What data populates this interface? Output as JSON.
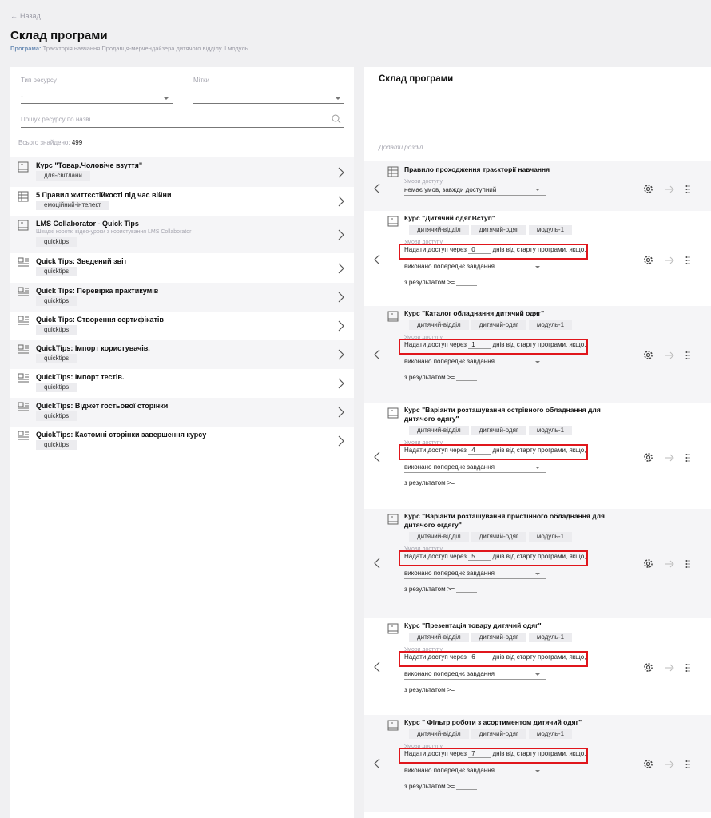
{
  "back_label": "Назад",
  "page_title": "Склад програми",
  "program": {
    "label": "Програма:",
    "value": "Траєкторія навчання Продавця-мерчендайзера дитячого відділу. I модуль"
  },
  "left_panel": {
    "resource_type_label": "Тип ресурсу",
    "resource_type_value": "-",
    "tags_label": "Мітки",
    "tags_value": "",
    "search_placeholder": "Пошук ресурсу по назві",
    "found_label": "Всього знайдено:",
    "found_count": "499",
    "resources": [
      {
        "icon": "course-icon",
        "title": "Курс \"Товар.Чоловіче взуття\"",
        "subtitle": "",
        "tag": "для-світлани"
      },
      {
        "icon": "trajectory-icon",
        "title": "5 Правил життєстійкості під час війни",
        "subtitle": "",
        "tag": "емоційний-інтелект"
      },
      {
        "icon": "course-icon",
        "title": "LMS Collaborator - Quick Tips",
        "subtitle": "Швидкі короткі відео-уроки з користування LMS Collaborator",
        "tag": "quicktips"
      },
      {
        "icon": "material-icon",
        "title": "Quick Tips: Зведений звіт",
        "subtitle": "",
        "tag": "quicktips"
      },
      {
        "icon": "material-icon",
        "title": "Quick Tips: Перевірка практикумів",
        "subtitle": "",
        "tag": "quicktips"
      },
      {
        "icon": "material-icon",
        "title": "Quick Tips: Створення сертифікатів",
        "subtitle": "",
        "tag": "quicktips"
      },
      {
        "icon": "material-icon",
        "title": "QuickTips: Імпорт користувачів.",
        "subtitle": "",
        "tag": "quicktips"
      },
      {
        "icon": "material-icon",
        "title": "QuickTips: Імпорт тестів.",
        "subtitle": "",
        "tag": "quicktips"
      },
      {
        "icon": "material-icon",
        "title": "QuickTips: Віджет гостьової сторінки",
        "subtitle": "",
        "tag": "quicktips"
      },
      {
        "icon": "material-icon",
        "title": "QuickTips: Кастомні сторінки завершення курсу",
        "subtitle": "",
        "tag": "quicktips"
      }
    ]
  },
  "right_panel": {
    "title": "Склад програми",
    "add_sections": "Додати розділ",
    "conditions_label": "Умови доступу",
    "first_item": {
      "title": "Правило проходження траєкторії навчання",
      "condition": "немає умов, завжди доступний"
    },
    "access_before": "Надати доступ через",
    "access_after": "днів від старту програми,",
    "if_label": "якщо,",
    "prev_task": "виконано попереднє завдання",
    "result_label": "з результатом >=",
    "tags": [
      "дитячий-відділ",
      "дитячий-одяг",
      "модуль-1"
    ],
    "items": [
      {
        "title": "Курс \"Дитячий одяг.Вступ\"",
        "days": "0"
      },
      {
        "title": "Курс \"Каталог обладнання дитячий одяг\"",
        "days": "1"
      },
      {
        "title": "Курс \"Варіанти розташування острівного обладнання для дитячого одягу\"",
        "days": "4"
      },
      {
        "title": "Курс \"Варіанти розташування пристінного обладнання для дитячого огдягу\"",
        "days": "5"
      },
      {
        "title": "Курс \"Презентація товару дитячий одяг\"",
        "days": "6"
      },
      {
        "title": "Курс \" Фільтр роботи з асортиментом дитячий одяг\"",
        "days": "7"
      }
    ]
  }
}
